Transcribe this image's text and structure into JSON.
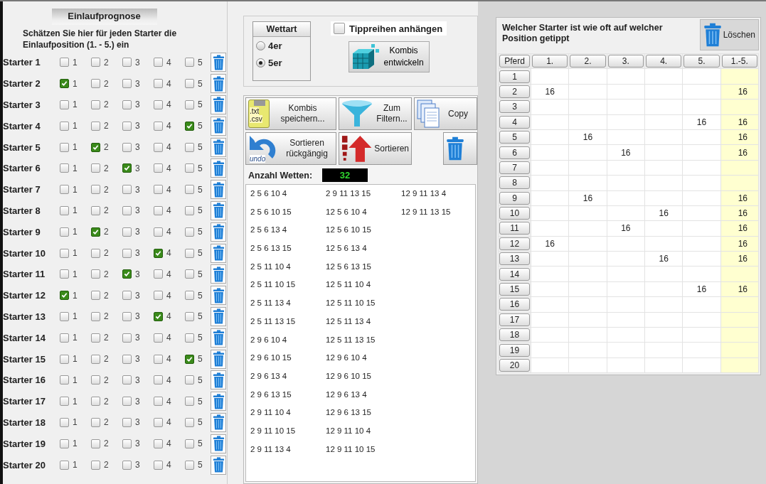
{
  "prognose": {
    "title": "Einlaufprognose",
    "description": "Schätzen Sie hier für jeden Starter die Einlaufposition (1. - 5.) ein",
    "starters": [
      {
        "label": "Starter 1",
        "positions": [
          {
            "label": "1",
            "checked": false
          },
          {
            "label": "2",
            "checked": false
          },
          {
            "label": "3",
            "checked": false
          },
          {
            "label": "4",
            "checked": false
          },
          {
            "label": "5",
            "checked": false
          }
        ]
      },
      {
        "label": "Starter 2",
        "positions": [
          {
            "label": "1",
            "checked": true
          },
          {
            "label": "2",
            "checked": false
          },
          {
            "label": "3",
            "checked": false
          },
          {
            "label": "4",
            "checked": false
          },
          {
            "label": "5",
            "checked": false
          }
        ]
      },
      {
        "label": "Starter 3",
        "positions": [
          {
            "label": "1",
            "checked": false
          },
          {
            "label": "2",
            "checked": false
          },
          {
            "label": "3",
            "checked": false
          },
          {
            "label": "4",
            "checked": false
          },
          {
            "label": "5",
            "checked": false
          }
        ]
      },
      {
        "label": "Starter 4",
        "positions": [
          {
            "label": "1",
            "checked": false
          },
          {
            "label": "2",
            "checked": false
          },
          {
            "label": "3",
            "checked": false
          },
          {
            "label": "4",
            "checked": false
          },
          {
            "label": "5",
            "checked": true
          }
        ]
      },
      {
        "label": "Starter 5",
        "positions": [
          {
            "label": "1",
            "checked": false
          },
          {
            "label": "2",
            "checked": true
          },
          {
            "label": "3",
            "checked": false
          },
          {
            "label": "4",
            "checked": false
          },
          {
            "label": "5",
            "checked": false
          }
        ]
      },
      {
        "label": "Starter 6",
        "positions": [
          {
            "label": "1",
            "checked": false
          },
          {
            "label": "2",
            "checked": false
          },
          {
            "label": "3",
            "checked": true
          },
          {
            "label": "4",
            "checked": false
          },
          {
            "label": "5",
            "checked": false
          }
        ]
      },
      {
        "label": "Starter 7",
        "positions": [
          {
            "label": "1",
            "checked": false
          },
          {
            "label": "2",
            "checked": false
          },
          {
            "label": "3",
            "checked": false
          },
          {
            "label": "4",
            "checked": false
          },
          {
            "label": "5",
            "checked": false
          }
        ]
      },
      {
        "label": "Starter 8",
        "positions": [
          {
            "label": "1",
            "checked": false
          },
          {
            "label": "2",
            "checked": false
          },
          {
            "label": "3",
            "checked": false
          },
          {
            "label": "4",
            "checked": false
          },
          {
            "label": "5",
            "checked": false
          }
        ]
      },
      {
        "label": "Starter 9",
        "positions": [
          {
            "label": "1",
            "checked": false
          },
          {
            "label": "2",
            "checked": true
          },
          {
            "label": "3",
            "checked": false
          },
          {
            "label": "4",
            "checked": false
          },
          {
            "label": "5",
            "checked": false
          }
        ]
      },
      {
        "label": "Starter 10",
        "positions": [
          {
            "label": "1",
            "checked": false
          },
          {
            "label": "2",
            "checked": false
          },
          {
            "label": "3",
            "checked": false
          },
          {
            "label": "4",
            "checked": true
          },
          {
            "label": "5",
            "checked": false
          }
        ]
      },
      {
        "label": "Starter 11",
        "positions": [
          {
            "label": "1",
            "checked": false
          },
          {
            "label": "2",
            "checked": false
          },
          {
            "label": "3",
            "checked": true
          },
          {
            "label": "4",
            "checked": false
          },
          {
            "label": "5",
            "checked": false
          }
        ]
      },
      {
        "label": "Starter 12",
        "positions": [
          {
            "label": "1",
            "checked": true
          },
          {
            "label": "2",
            "checked": false
          },
          {
            "label": "3",
            "checked": false
          },
          {
            "label": "4",
            "checked": false
          },
          {
            "label": "5",
            "checked": false
          }
        ]
      },
      {
        "label": "Starter 13",
        "positions": [
          {
            "label": "1",
            "checked": false
          },
          {
            "label": "2",
            "checked": false
          },
          {
            "label": "3",
            "checked": false
          },
          {
            "label": "4",
            "checked": true
          },
          {
            "label": "5",
            "checked": false
          }
        ]
      },
      {
        "label": "Starter 14",
        "positions": [
          {
            "label": "1",
            "checked": false
          },
          {
            "label": "2",
            "checked": false
          },
          {
            "label": "3",
            "checked": false
          },
          {
            "label": "4",
            "checked": false
          },
          {
            "label": "5",
            "checked": false
          }
        ]
      },
      {
        "label": "Starter 15",
        "positions": [
          {
            "label": "1",
            "checked": false
          },
          {
            "label": "2",
            "checked": false
          },
          {
            "label": "3",
            "checked": false
          },
          {
            "label": "4",
            "checked": false
          },
          {
            "label": "5",
            "checked": true
          }
        ]
      },
      {
        "label": "Starter 16",
        "positions": [
          {
            "label": "1",
            "checked": false
          },
          {
            "label": "2",
            "checked": false
          },
          {
            "label": "3",
            "checked": false
          },
          {
            "label": "4",
            "checked": false
          },
          {
            "label": "5",
            "checked": false
          }
        ]
      },
      {
        "label": "Starter 17",
        "positions": [
          {
            "label": "1",
            "checked": false
          },
          {
            "label": "2",
            "checked": false
          },
          {
            "label": "3",
            "checked": false
          },
          {
            "label": "4",
            "checked": false
          },
          {
            "label": "5",
            "checked": false
          }
        ]
      },
      {
        "label": "Starter 18",
        "positions": [
          {
            "label": "1",
            "checked": false
          },
          {
            "label": "2",
            "checked": false
          },
          {
            "label": "3",
            "checked": false
          },
          {
            "label": "4",
            "checked": false
          },
          {
            "label": "5",
            "checked": false
          }
        ]
      },
      {
        "label": "Starter 19",
        "positions": [
          {
            "label": "1",
            "checked": false
          },
          {
            "label": "2",
            "checked": false
          },
          {
            "label": "3",
            "checked": false
          },
          {
            "label": "4",
            "checked": false
          },
          {
            "label": "5",
            "checked": false
          }
        ]
      },
      {
        "label": "Starter 20",
        "positions": [
          {
            "label": "1",
            "checked": false
          },
          {
            "label": "2",
            "checked": false
          },
          {
            "label": "3",
            "checked": false
          },
          {
            "label": "4",
            "checked": false
          },
          {
            "label": "5",
            "checked": false
          }
        ]
      }
    ]
  },
  "wettart": {
    "title": "Wettart",
    "options": [
      {
        "label": "4er",
        "selected": false
      },
      {
        "label": "5er",
        "selected": true
      }
    ]
  },
  "append_checkbox": {
    "label": "Tippreihen anhängen",
    "checked": false
  },
  "develop_button": "Kombis entwickeln",
  "toolbar": [
    {
      "kind": "save",
      "label": "Kombis speichern...",
      "icon_text": [
        ".txt",
        ".csv"
      ]
    },
    {
      "kind": "filter",
      "label": "Zum Filtern..."
    },
    {
      "kind": "copy",
      "label": "Copy"
    },
    {
      "kind": "undo",
      "label": "Sortieren rückgängig",
      "icon_text": [
        "undo"
      ]
    },
    {
      "kind": "sort",
      "label": "Sortieren"
    },
    {
      "kind": "gap"
    },
    {
      "kind": "delete"
    }
  ],
  "bet_count": {
    "label": "Anzahl Wetten:",
    "value": "32"
  },
  "combinations": [
    "2 5 6 10 4",
    "2 5 6 10 15",
    "2 5 6 13 4",
    "2 5 6 13 15",
    "2 5 11 10 4",
    "2 5 11 10 15",
    "2 5 11 13 4",
    "2 5 11 13 15",
    "2 9 6 10 4",
    "2 9 6 10 15",
    "2 9 6 13 4",
    "2 9 6 13 15",
    "2 9 11 10 4",
    "2 9 11 10 15",
    "2 9 11 13 4",
    "2 9 11 13 15",
    "12 5 6 10 4",
    "12 5 6 10 15",
    "12 5 6 13 4",
    "12 5 6 13 15",
    "12 5 11 10 4",
    "12 5 11 10 15",
    "12 5 11 13 4",
    "12 5 11 13 15",
    "12 9 6 10 4",
    "12 9 6 10 15",
    "12 9 6 13 4",
    "12 9 6 13 15",
    "12 9 11 10 4",
    "12 9 11 10 15",
    "12 9 11 13 4",
    "12 9 11 13 15"
  ],
  "stats": {
    "title": "Welcher Starter ist wie oft auf welcher Position getippt",
    "clear_button": "Löschen",
    "table": {
      "columns": [
        "Pferd",
        "1.",
        "2.",
        "3.",
        "4.",
        "5.",
        "1.-5."
      ],
      "rows": [
        [
          "1",
          "",
          "",
          "",
          "",
          "",
          ""
        ],
        [
          "2",
          "16",
          "",
          "",
          "",
          "",
          "16"
        ],
        [
          "3",
          "",
          "",
          "",
          "",
          "",
          ""
        ],
        [
          "4",
          "",
          "",
          "",
          "",
          "16",
          "16"
        ],
        [
          "5",
          "",
          "16",
          "",
          "",
          "",
          "16"
        ],
        [
          "6",
          "",
          "",
          "16",
          "",
          "",
          "16"
        ],
        [
          "7",
          "",
          "",
          "",
          "",
          "",
          ""
        ],
        [
          "8",
          "",
          "",
          "",
          "",
          "",
          ""
        ],
        [
          "9",
          "",
          "16",
          "",
          "",
          "",
          "16"
        ],
        [
          "10",
          "",
          "",
          "",
          "16",
          "",
          "16"
        ],
        [
          "11",
          "",
          "",
          "16",
          "",
          "",
          "16"
        ],
        [
          "12",
          "16",
          "",
          "",
          "",
          "",
          "16"
        ],
        [
          "13",
          "",
          "",
          "",
          "16",
          "",
          "16"
        ],
        [
          "14",
          "",
          "",
          "",
          "",
          "",
          ""
        ],
        [
          "15",
          "",
          "",
          "",
          "",
          "16",
          "16"
        ],
        [
          "16",
          "",
          "",
          "",
          "",
          "",
          ""
        ],
        [
          "17",
          "",
          "",
          "",
          "",
          "",
          ""
        ],
        [
          "18",
          "",
          "",
          "",
          "",
          "",
          ""
        ],
        [
          "19",
          "",
          "",
          "",
          "",
          "",
          ""
        ],
        [
          "20",
          "",
          "",
          "",
          "",
          "",
          ""
        ]
      ]
    }
  }
}
